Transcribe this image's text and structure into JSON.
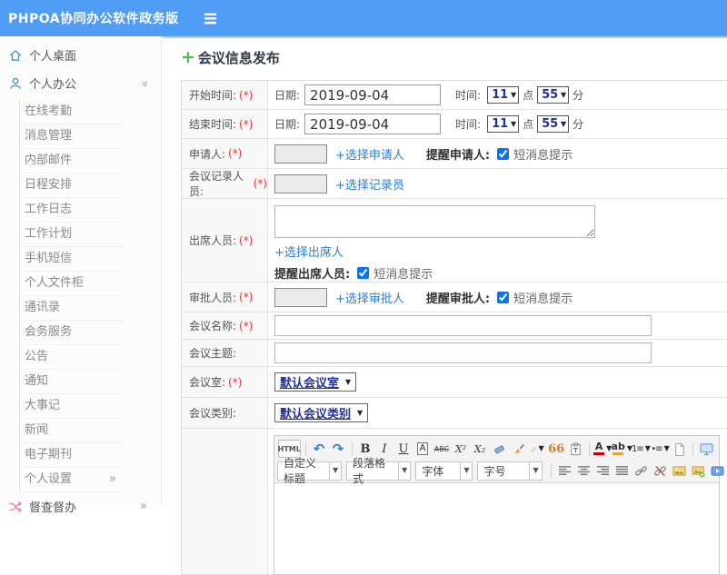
{
  "header": {
    "app_title": "PHPOA协同办公软件政务版"
  },
  "sidebar": {
    "desktop": "个人桌面",
    "office": "个人办公",
    "sub_items": [
      "在线考勤",
      "消息管理",
      "内部邮件",
      "日程安排",
      "工作日志",
      "工作计划",
      "手机短信",
      "个人文件柜",
      "通讯录",
      "会务服务",
      "公告",
      "通知",
      "大事记",
      "新闻",
      "电子期刊"
    ],
    "settings": "个人设置",
    "supervise": "督查督办",
    "arrow": "»"
  },
  "main": {
    "page_title": "会议信息发布"
  },
  "form": {
    "required_mark": "(*)",
    "start_time": {
      "label": "开始时间:",
      "date_label": "日期:",
      "date_value": "2019-09-04",
      "time_label": "时间:",
      "hour": "11",
      "hour_unit": "点",
      "minute": "55",
      "minute_unit": "分"
    },
    "end_time": {
      "label": "结束时间:",
      "date_label": "日期:",
      "date_value": "2019-09-04",
      "time_label": "时间:",
      "hour": "11",
      "hour_unit": "点",
      "minute": "55",
      "minute_unit": "分"
    },
    "applicant": {
      "label": "申请人:",
      "link": "+选择申请人",
      "remind_label": "提醒申请人:",
      "sms_label": "短消息提示"
    },
    "recorder": {
      "label": "会议记录人员:",
      "link": "+选择记录员"
    },
    "attendees": {
      "label": "出席人员:",
      "link": "+选择出席人",
      "remind_label": "提醒出席人员:",
      "sms_label": "短消息提示"
    },
    "approver": {
      "label": "审批人员:",
      "link": "+选择审批人",
      "remind_label": "提醒审批人:",
      "sms_label": "短消息提示"
    },
    "meeting_name": {
      "label": "会议名称:"
    },
    "meeting_topic": {
      "label": "会议主题:"
    },
    "meeting_room": {
      "label": "会议室:",
      "value": "默认会议室"
    },
    "meeting_type": {
      "label": "会议类别:",
      "value": "默认会议类别"
    }
  },
  "editor": {
    "toolbar": {
      "html": "HTML",
      "bold": "B",
      "italic": "I",
      "underline": "U",
      "font_box": "A",
      "strike": "ABC",
      "superscript": "X²",
      "subscript": "X₂",
      "quote": "66",
      "font_color": "A",
      "highlight": "ab",
      "heading_select": "自定义标题",
      "paragraph_select": "段落格式",
      "font_select": "字体",
      "size_select": "字号"
    }
  },
  "icons": {
    "hamburger": "≡",
    "plus": "+",
    "caret": "▼",
    "chevron_double": "»",
    "undo": "↶",
    "redo": "↷",
    "ordered_list": "1≡",
    "bullet_list": "•≡"
  },
  "colors": {
    "header_blue": "#4f9df5",
    "link_blue": "#2d7fd0",
    "accent_green": "#55b855",
    "required_red": "#ee3333",
    "select_navy": "#22309c"
  }
}
